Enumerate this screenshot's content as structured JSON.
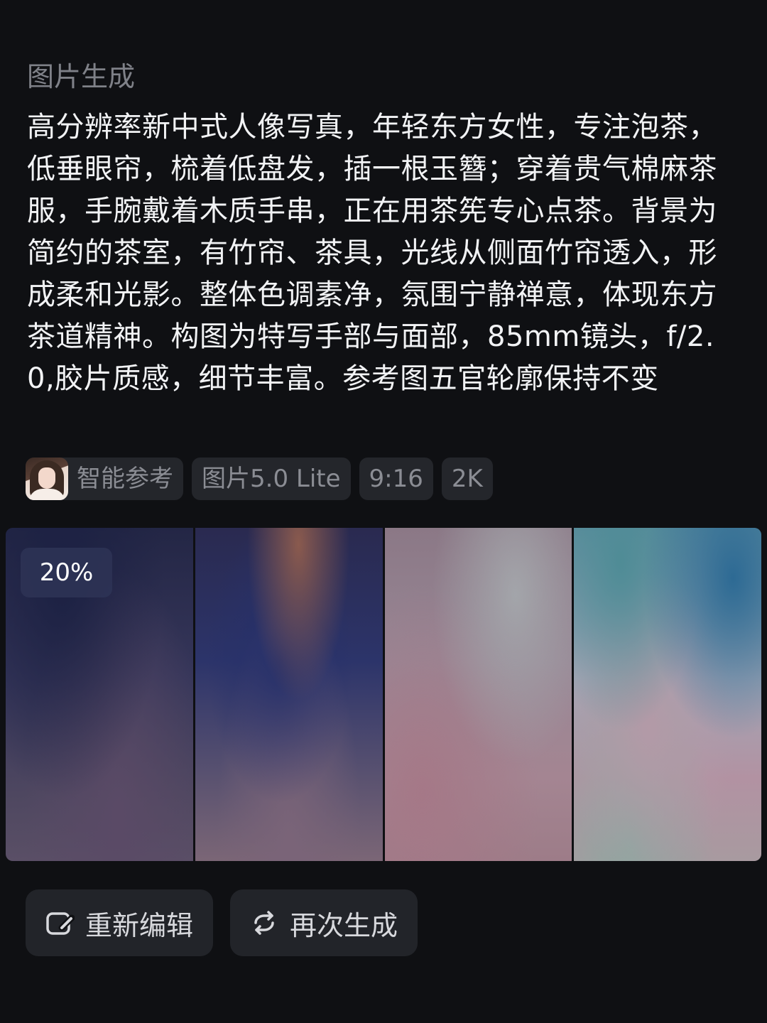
{
  "header": {
    "section_label": "图片生成"
  },
  "prompt": {
    "text": "高分辨率新中式人像写真，年轻东方女性，专注泡茶，低垂眼帘，梳着低盘发，插一根玉簪；穿着贵气棉麻茶服，手腕戴着木质手串，正在用茶筅专心点茶。背景为简约的茶室，有竹帘、茶具，光线从侧面竹帘透入，形成柔和光影。整体色调素净，氛围宁静禅意，体现东方茶道精神。构图为特写手部与面部，85mm镜头，f/2.0,胶片质感，细节丰富。参考图五官轮廓保持不变"
  },
  "tags": {
    "reference_label": "智能参考",
    "model_label": "图片5.0 Lite",
    "ratio_label": "9:16",
    "resolution_label": "2K"
  },
  "preview": {
    "progress_label": "20%",
    "progress_value": 20,
    "panel_count": 4
  },
  "actions": {
    "edit_label": "重新编辑",
    "regenerate_label": "再次生成"
  },
  "icons": {
    "edit": "edit-icon",
    "regenerate": "refresh-icon"
  },
  "colors": {
    "background": "#0f1013",
    "text_primary": "#f2f3f5",
    "text_muted": "#7f8188",
    "tag_bg": "#24262b",
    "button_bg": "#222429"
  }
}
